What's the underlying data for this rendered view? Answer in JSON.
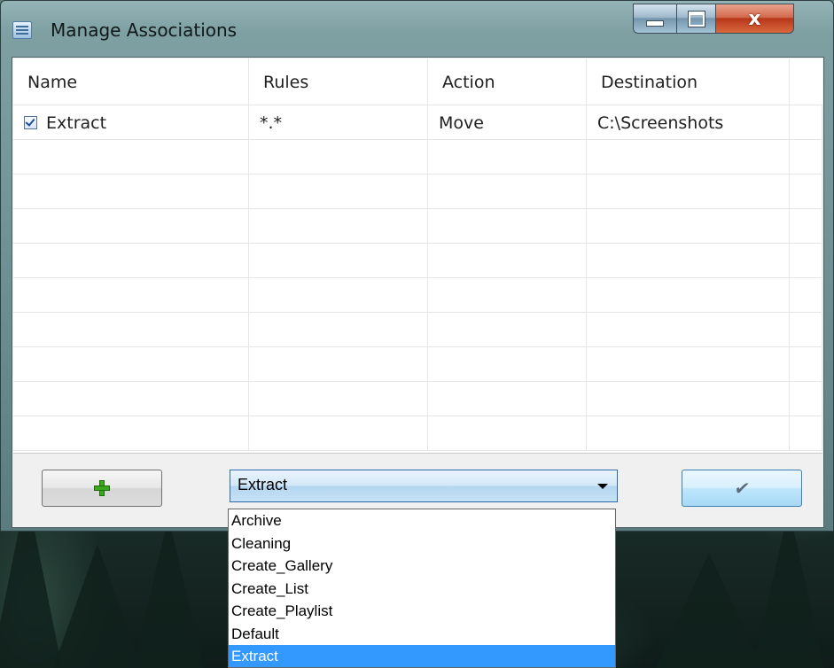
{
  "window": {
    "title": "Manage Associations",
    "icon": "list-window-icon",
    "controls": {
      "minimize": "minimize-icon",
      "maximize": "maximize-icon",
      "close": "close-icon",
      "close_glyph": "x"
    }
  },
  "grid": {
    "columns": [
      "Name",
      "Rules",
      "Action",
      "Destination"
    ],
    "rows": [
      {
        "checked": true,
        "name": "Extract",
        "rules": "*.*",
        "action": "Move",
        "destination": "C:\\Screenshots"
      }
    ]
  },
  "toolbar": {
    "add_icon": "plus-icon",
    "confirm_icon": "checkmark-icon",
    "confirm_glyph": "✔",
    "accent_color": "#3399ff"
  },
  "combo": {
    "selected": "Extract",
    "options": [
      "Archive",
      "Cleaning",
      "Create_Gallery",
      "Create_List",
      "Create_Playlist",
      "Default",
      "Extract"
    ]
  }
}
